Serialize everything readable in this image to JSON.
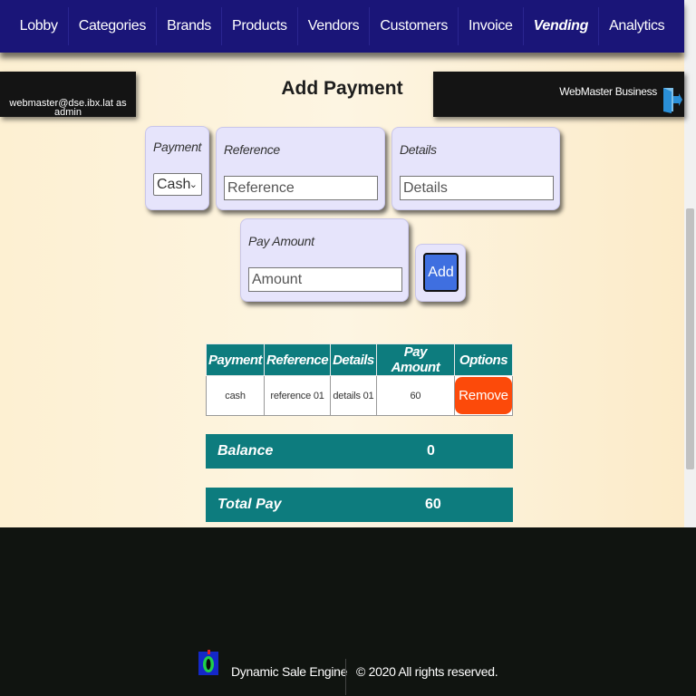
{
  "nav": {
    "items": [
      "Lobby",
      "Categories",
      "Brands",
      "Products",
      "Vendors",
      "Customers",
      "Invoice",
      "Vending",
      "Analytics"
    ],
    "active": "Vending"
  },
  "header": {
    "user": "webmaster@dse.ibx.lat as admin",
    "title": "Add Payment",
    "business": "WebMaster Business"
  },
  "form": {
    "payment_label": "Payment",
    "payment_value": "Cash",
    "reference_label": "Reference",
    "reference_placeholder": "Reference",
    "details_label": "Details",
    "details_placeholder": "Details",
    "amount_label": "Pay Amount",
    "amount_placeholder": "Amount",
    "add_label": "Add"
  },
  "table": {
    "columns": [
      "Payment",
      "Reference",
      "Details",
      "Pay Amount",
      "Options"
    ],
    "rows": [
      {
        "payment": "cash",
        "reference": "reference 01",
        "details": "details 01",
        "amount": "60",
        "option": "Remove"
      }
    ]
  },
  "summary": {
    "balance_label": "Balance",
    "balance_value": "0",
    "total_label": "Total Pay",
    "total_value": "60"
  },
  "footer": {
    "name": "Dynamic Sale Engine",
    "copyright": "© 2020 All rights reserved."
  },
  "colors": {
    "nav_bg": "#1a1578",
    "teal": "#0d7c7e",
    "remove": "#fc4a0a",
    "add": "#3f6fe0"
  }
}
